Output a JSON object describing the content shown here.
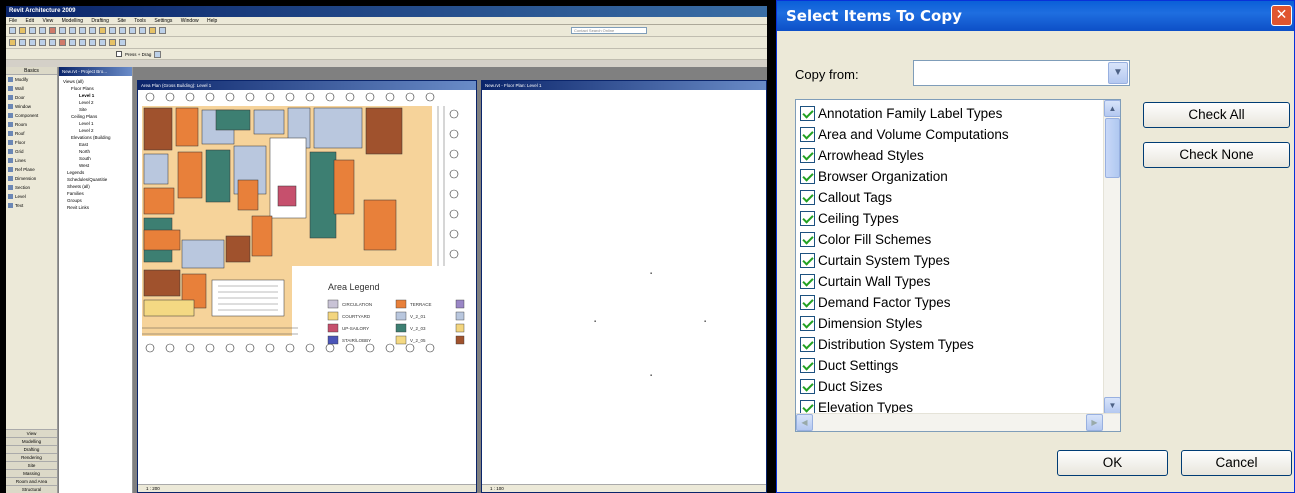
{
  "revit": {
    "title": "Revit Architecture 2009",
    "menus": [
      "File",
      "Edit",
      "View",
      "Modelling",
      "Drafting",
      "Site",
      "Tools",
      "Settings",
      "Window",
      "Help"
    ],
    "search_placeholder": "Contact Search Online",
    "options_label": "Press + Drag",
    "designbar": {
      "header": "Basics",
      "items": [
        "Modify",
        "Wall",
        "Door",
        "Window",
        "Component",
        "Room",
        "Roof",
        "Floor",
        "Grid",
        "Lines",
        "Ref Plane",
        "Dimension",
        "Section",
        "Level",
        "Text"
      ],
      "tabs": [
        "View",
        "Modelling",
        "Drafting",
        "Rendering",
        "Site",
        "Massing",
        "Room and Area",
        "Structural"
      ]
    },
    "browser": {
      "title": "New.rvt - Project Bro...",
      "tree": [
        "Views (all)",
        "Floor Plans",
        "Level 1",
        "Level 2",
        "Site",
        "Ceiling Plans",
        "Level 1",
        "Level 2",
        "Elevations (Building",
        "East",
        "North",
        "South",
        "West",
        "Legends",
        "Schedules/Quantitie",
        "Sheets (all)",
        "Families",
        "Groups",
        "Revit Links"
      ]
    },
    "view1": {
      "title": "Area Plan (Gross Building): Level 1",
      "scale": "1 : 200",
      "legend_title": "Area Legend",
      "legend": [
        {
          "label": "CIRCULATION",
          "color": "#c9c3d6"
        },
        {
          "label": "COURTYARD",
          "color": "#f3d57e"
        },
        {
          "label": "UP-SAILORY",
          "color": "#c6506d"
        },
        {
          "label": "STAIR/LOBBY",
          "color": "#4b55b8"
        },
        {
          "label": "TERRACE",
          "color": "#e8803a"
        },
        {
          "label": "V_2_01",
          "color": "#b9c7de"
        },
        {
          "label": "V_2_03",
          "color": "#3d7f72"
        },
        {
          "label": "V_2_05",
          "color": "#f4d983"
        }
      ]
    },
    "view2": {
      "title": "New.rvt - Floor Plan: Level 1",
      "scale": "1 : 100"
    }
  },
  "dialog": {
    "title": "Select Items To Copy",
    "copy_from_label": "Copy from:",
    "copy_from_value": "",
    "items": [
      "Annotation Family Label Types",
      "Area and Volume Computations",
      "Arrowhead Styles",
      "Browser Organization",
      "Callout Tags",
      "Ceiling Types",
      "Color Fill Schemes",
      "Curtain System Types",
      "Curtain Wall Types",
      "Demand Factor Types",
      "Dimension Styles",
      "Distribution System Types",
      "Duct Settings",
      "Duct Sizes",
      "Elevation Types"
    ],
    "check_all_label": "Check All",
    "check_none_label": "Check None",
    "ok_label": "OK",
    "cancel_label": "Cancel"
  }
}
